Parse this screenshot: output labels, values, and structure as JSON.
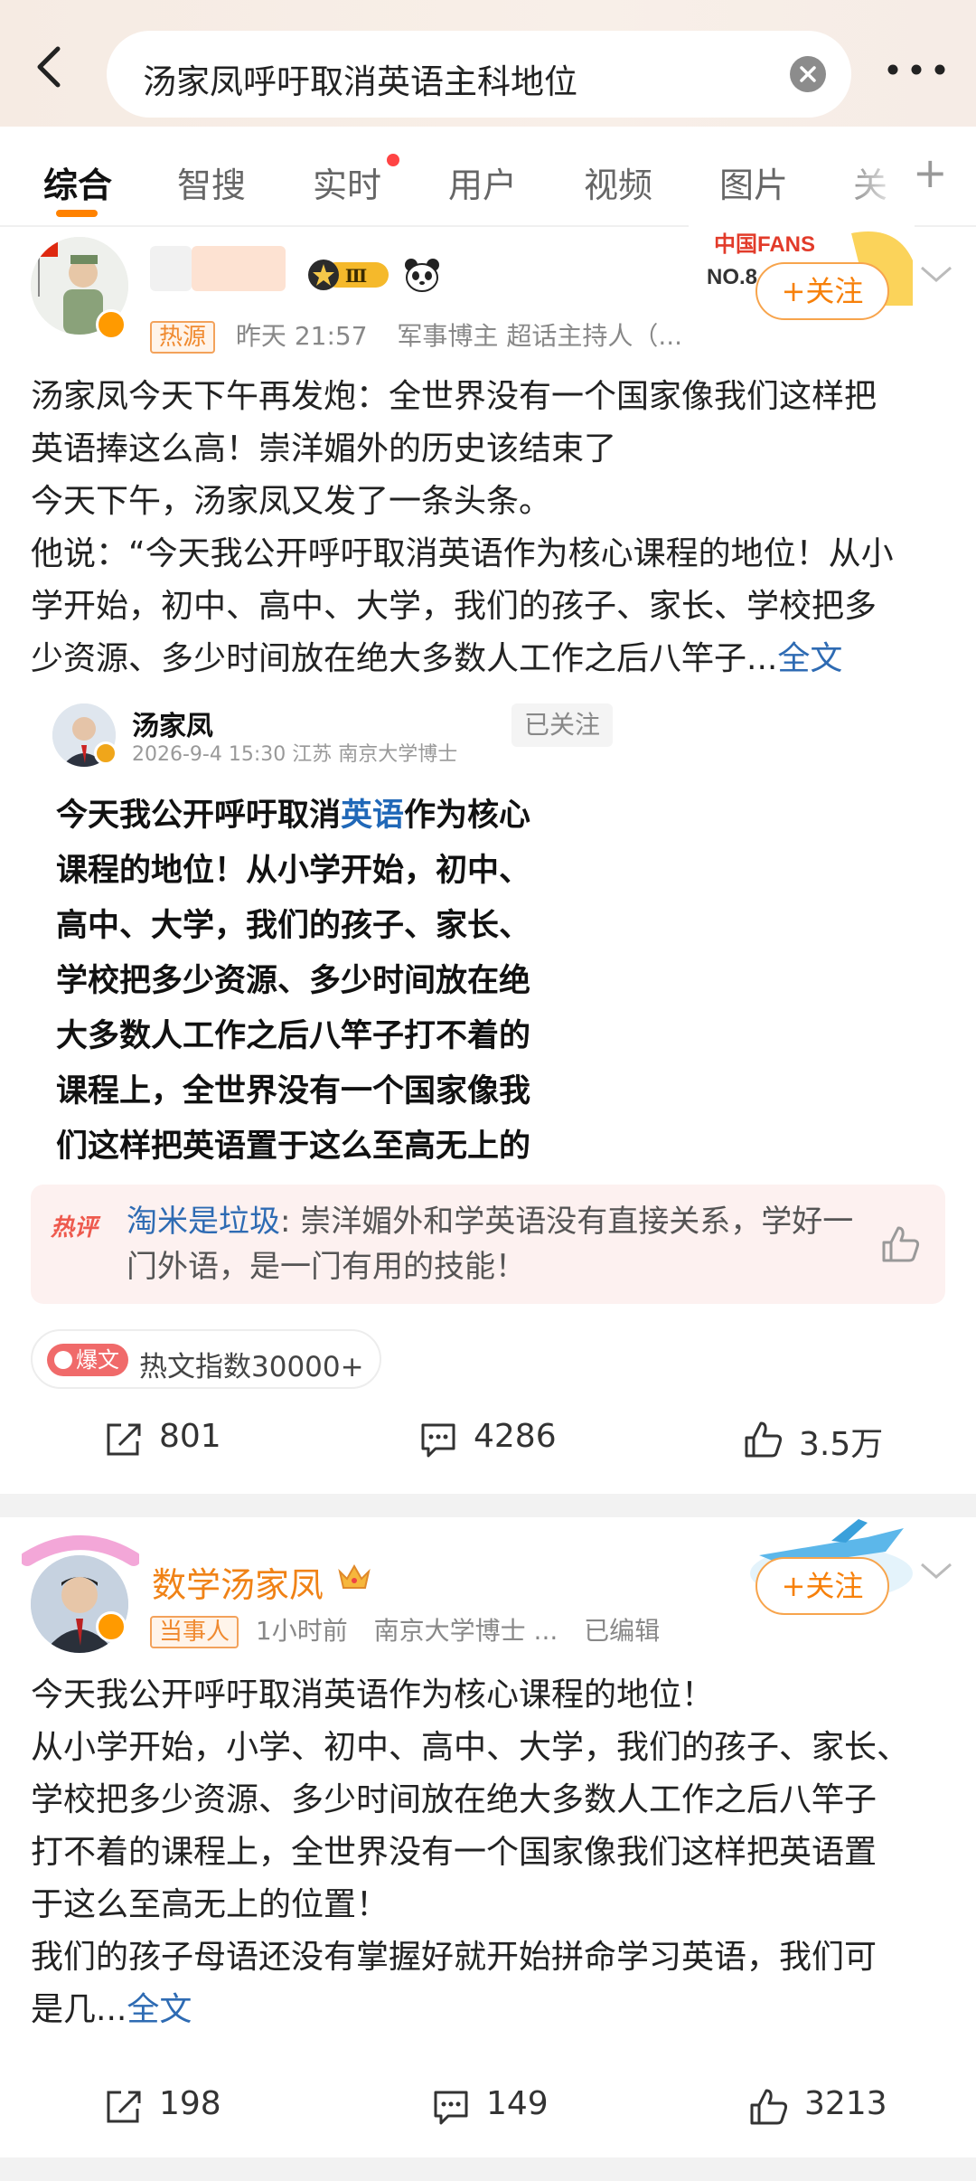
{
  "search": {
    "query": "汤家凤呼吁取消英语主科地位"
  },
  "tabs": [
    {
      "label": "综合"
    },
    {
      "label": "智搜"
    },
    {
      "label": "实时"
    },
    {
      "label": "用户"
    },
    {
      "label": "视频"
    },
    {
      "label": "图片"
    },
    {
      "label": "关"
    }
  ],
  "post1": {
    "fans_badge": "中国FANS",
    "fans_rank": "NO.8",
    "level_badge": "Ⅲ",
    "follow_label": "+关注",
    "tag": "热源",
    "time": "昨天 21:57",
    "desc": "军事博主 超话主持人（...",
    "text_lines": [
      "汤家凤今天下午再发炮：全世界没有一个国家像我们这样把",
      "英语捧这么高！崇洋媚外的历史该结束了",
      "今天下午，汤家凤又发了一条头条。",
      "他说：“今天我公开呼吁取消英语作为核心课程的地位！从小",
      "学开始，初中、高中、大学，我们的孩子、家长、学校把多",
      "少资源、多少时间放在绝大多数人工作之后八竿子..."
    ],
    "full_text_link": "全文",
    "quote": {
      "name": "汤家凤",
      "meta": "2026-9-4 15:30 江苏 南京大学博士",
      "followed": "已关注",
      "line1_pre": "今天我公开呼吁取消",
      "line1_hl": "英语",
      "line1_post": "作为核心",
      "lines": [
        "课程的地位！从小学开始，初中、",
        "高中、大学，我们的孩子、家长、",
        "学校把多少资源、多少时间放在绝",
        "大多数人工作之后八竿子打不着的",
        "课程上，全世界没有一个国家像我",
        "们这样把英语置于这么至高无上的"
      ]
    },
    "hot_comment": {
      "label": "热评",
      "user": "淘米是垃圾",
      "text": ": 崇洋媚外和学英语没有直接关系，学好一门外语，是一门有用的技能！"
    },
    "hot_index": {
      "badge": "爆文",
      "text": "热文指数30000+"
    },
    "actions": {
      "repost": "801",
      "comment": "4286",
      "like": "3.5万"
    }
  },
  "post2": {
    "name": "数学汤家凤",
    "follow_label": "+关注",
    "tag": "当事人",
    "time": "1小时前",
    "desc": "南京大学博士 ...",
    "edited": "已编辑",
    "text_lines": [
      "今天我公开呼吁取消英语作为核心课程的地位！",
      "从小学开始，小学、初中、高中、大学，我们的孩子、家长、",
      "学校把多少资源、多少时间放在绝大多数人工作之后八竿子",
      "打不着的课程上，全世界没有一个国家像我们这样把英语置",
      "于这么至高无上的位置！",
      "我们的孩子母语还没有掌握好就开始拼命学习英语，我们可",
      "是几..."
    ],
    "full_text_link": "全文",
    "actions": {
      "repost": "198",
      "comment": "149",
      "like": "3213"
    }
  },
  "colors": {
    "accent": "#ff8200",
    "link": "#2e6bb3",
    "name_orange": "#f08216"
  }
}
